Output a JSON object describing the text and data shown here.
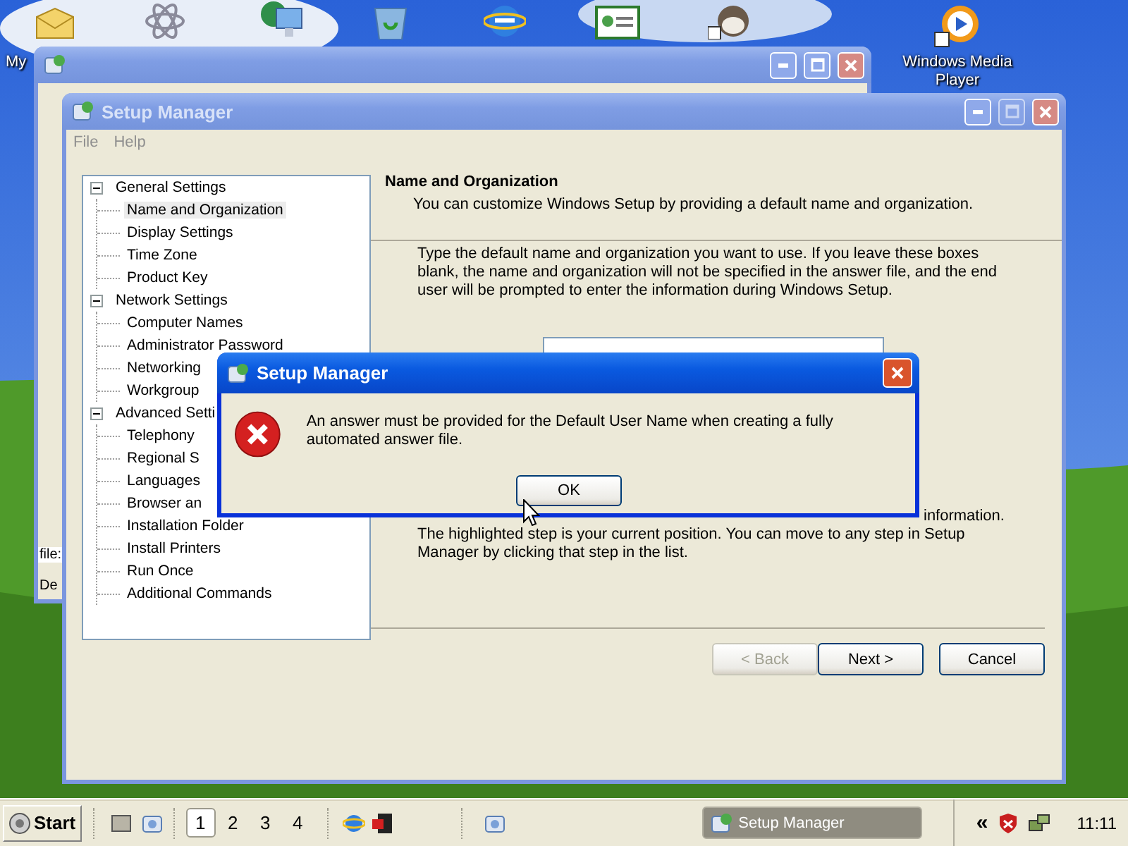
{
  "desktop": {
    "icons": [
      {
        "label": "My"
      },
      {
        "label": "Windows Media Player"
      }
    ]
  },
  "back_window": {
    "active": false,
    "texts": [
      "file:",
      "De"
    ]
  },
  "main_window": {
    "title": "Setup Manager",
    "active": false,
    "menu": [
      "File",
      "Help"
    ],
    "tree": [
      {
        "label": "General Settings",
        "expanded": true,
        "selected": false,
        "children": [
          {
            "label": "Name and Organization",
            "selected": true
          },
          {
            "label": "Display Settings",
            "selected": false
          },
          {
            "label": "Time Zone",
            "selected": false
          },
          {
            "label": "Product Key",
            "selected": false
          }
        ]
      },
      {
        "label": "Network Settings",
        "expanded": true,
        "selected": false,
        "children": [
          {
            "label": "Computer Names",
            "selected": false
          },
          {
            "label": "Administrator Password",
            "selected": false
          },
          {
            "label": "Networking",
            "selected": false
          },
          {
            "label": "Workgroup",
            "selected": false
          }
        ]
      },
      {
        "label": "Advanced Setti",
        "expanded": true,
        "selected": false,
        "children": [
          {
            "label": "Telephony",
            "selected": false
          },
          {
            "label": "Regional S",
            "selected": false
          },
          {
            "label": "Languages",
            "selected": false
          },
          {
            "label": "Browser an",
            "selected": false
          },
          {
            "label": "Installation Folder",
            "selected": false
          },
          {
            "label": "Install Printers",
            "selected": false
          },
          {
            "label": "Run Once",
            "selected": false
          },
          {
            "label": "Additional Commands",
            "selected": false
          }
        ]
      }
    ],
    "heading": "Name and Organization",
    "subheading": "You can customize Windows Setup by providing a default name and organization.",
    "instructions": "Type the default name and organization you want to use. If you leave these boxes blank, the name and organization will not be specified in the answer file, and the end user will be prompted to enter the information during Windows Setup.",
    "hint_tail": "information.",
    "hint": "The highlighted step is your current position. You can move to any step in Setup Manager by clicking that step in the list.",
    "buttons": [
      {
        "label": "< Back",
        "disabled": true
      },
      {
        "label": "Next >",
        "disabled": false
      },
      {
        "label": "Cancel",
        "disabled": false
      }
    ]
  },
  "dialog": {
    "title": "Setup Manager",
    "active": true,
    "message": "An answer must be provided for the Default User Name when creating a fully automated answer file.",
    "button": "OK"
  },
  "taskbar": {
    "start": "Start",
    "workspaces": [
      {
        "label": "1",
        "selected": true
      },
      {
        "label": "2",
        "selected": false
      },
      {
        "label": "3",
        "selected": false
      },
      {
        "label": "4",
        "selected": false
      }
    ],
    "tasks": [
      {
        "label": "Setup Manager",
        "selected": false
      }
    ],
    "tray_toggle": "«",
    "clock": "11:11"
  }
}
